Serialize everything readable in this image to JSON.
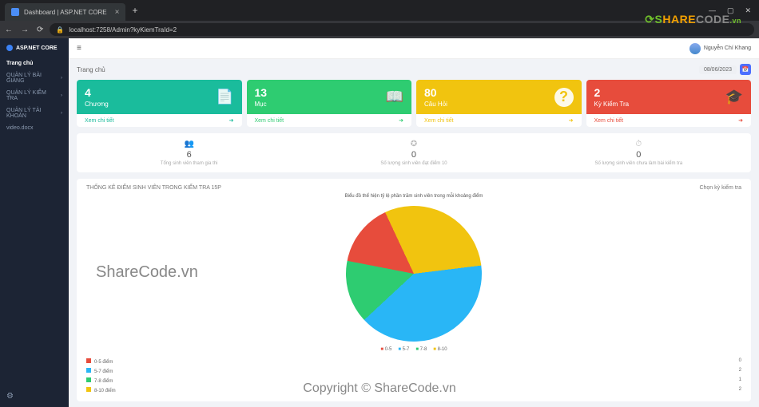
{
  "browser": {
    "tab_title": "Dashboard | ASP.NET CORE",
    "url": "localhost:7258/Admin?kyKiemTraId=2"
  },
  "watermark_logo": "SHARECODE.vn",
  "watermark_center": "ShareCode.vn",
  "watermark_bottom": "Copyright © ShareCode.vn",
  "sidebar": {
    "brand": "ASP.NET CORE",
    "heading": "Trang chủ",
    "items": [
      {
        "label": "QUẢN LÝ BÀI GIẢNG"
      },
      {
        "label": "QUẢN LÝ KIỂM TRA"
      },
      {
        "label": "QUẢN LÝ TÀI KHOẢN"
      },
      {
        "label": "video.docx"
      }
    ]
  },
  "topbar": {
    "username": "Nguyễn Chí Khang"
  },
  "breadcrumb": "Trang chủ",
  "date": "08/06/2023",
  "stat_cards": [
    {
      "value": "4",
      "label": "Chương",
      "link": "Xem chi tiết",
      "icon": "📄"
    },
    {
      "value": "13",
      "label": "Mục",
      "link": "Xem chi tiết",
      "icon": "📖"
    },
    {
      "value": "80",
      "label": "Câu Hỏi",
      "link": "Xem chi tiết",
      "icon": "?"
    },
    {
      "value": "2",
      "label": "Kỳ Kiểm Tra",
      "link": "Xem chi tiết",
      "icon": "🎓"
    }
  ],
  "mid_stats": [
    {
      "value": "6",
      "label": "Tổng sinh viên tham gia thi",
      "icon": "👥"
    },
    {
      "value": "0",
      "label": "Số lượng sinh viên đạt điểm 10",
      "icon": "✪"
    },
    {
      "value": "0",
      "label": "Số lượng sinh viên chưa làm bài kiểm tra",
      "icon": "⏱"
    }
  ],
  "panel": {
    "title_left": "THỐNG KÊ ĐIỂM SINH VIÊN TRONG KIỂM TRA 15P",
    "title_right": "Chọn kỳ kiểm tra",
    "chart_heading": "Biểu đồ thể hiện tỷ lệ phần trăm sinh viên trong mỗi khoảng điểm"
  },
  "chart_data": {
    "type": "pie",
    "title": "Biểu đồ thể hiện tỷ lệ phần trăm sinh viên trong mỗi khoảng điểm",
    "series": [
      {
        "name": "0-5",
        "label": "0-5 điểm",
        "value": 0,
        "percent": 15,
        "color": "#e74c3c"
      },
      {
        "name": "5-7",
        "label": "5-7 điểm",
        "value": 2,
        "percent": 40,
        "color": "#29b6f6"
      },
      {
        "name": "7-8",
        "label": "7-8 điểm",
        "value": 1,
        "percent": 15,
        "color": "#2ecc71"
      },
      {
        "name": "8-10",
        "label": "8-10 điểm",
        "value": 2,
        "percent": 30,
        "color": "#f1c40f"
      }
    ],
    "legend_short": [
      "0-5",
      "5-7",
      "7-8",
      "8-10"
    ]
  }
}
